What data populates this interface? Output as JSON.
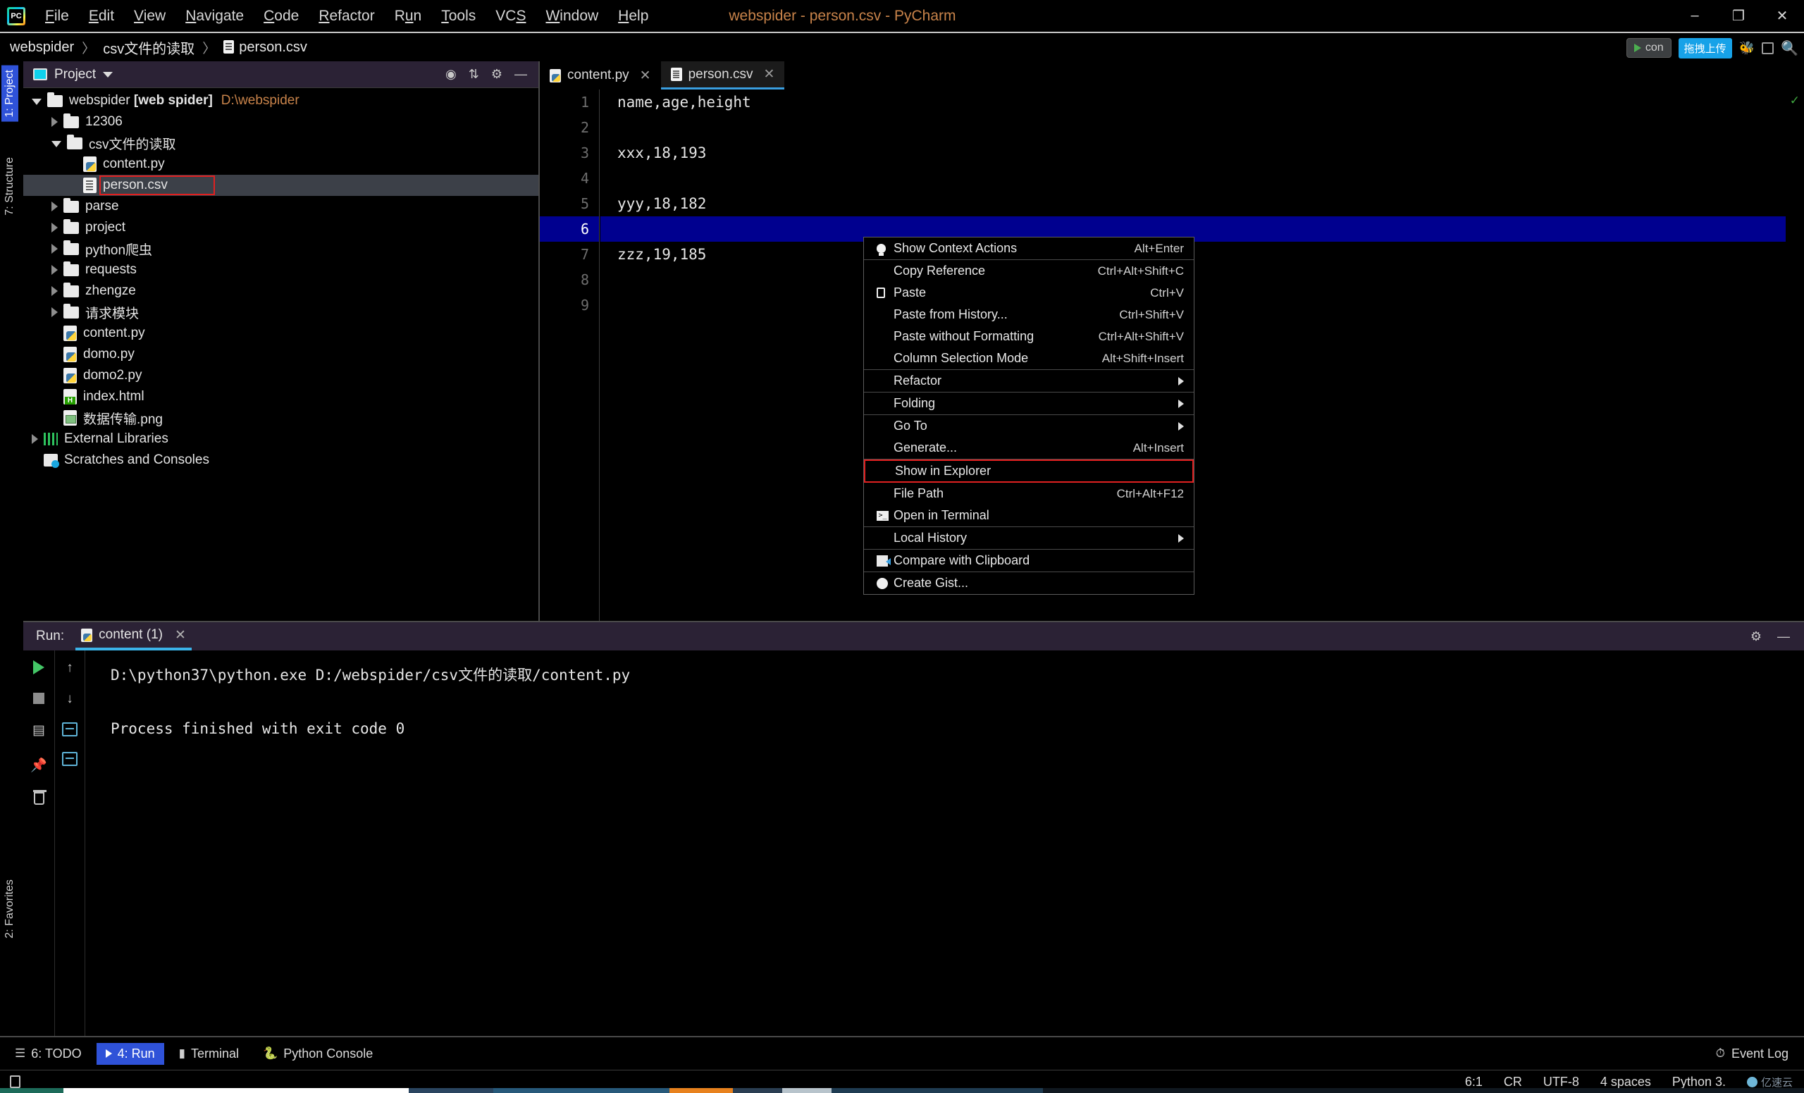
{
  "titlebar": {
    "app_icon": "pycharm-logo",
    "menus": [
      "File",
      "Edit",
      "View",
      "Navigate",
      "Code",
      "Refactor",
      "Run",
      "Tools",
      "VCS",
      "Window",
      "Help"
    ],
    "window_title": "webspider - person.csv - PyCharm",
    "title_color": "#c8834a",
    "minimize": "–",
    "maximize": "❐",
    "close": "✕"
  },
  "breadcrumb": {
    "items": [
      "webspider",
      "csv文件的读取",
      "person.csv"
    ],
    "separator": "〉",
    "run_config": "con",
    "badge_cn": "拖拽上传",
    "icons": [
      "bug-icon",
      "stop-icon",
      "search-icon"
    ]
  },
  "left_strip": {
    "tabs": [
      "1: Project",
      "7: Structure",
      "2: Favorites"
    ],
    "selected": "1: Project"
  },
  "project_panel": {
    "title": "Project",
    "header_icons": [
      "target-icon",
      "collapse-all-icon",
      "gear-icon",
      "hide-icon"
    ],
    "tree": [
      {
        "label": "webspider [web spider]",
        "path": "D:\\webspider",
        "icon": "folder",
        "depth": 0,
        "arrow": "open",
        "bold_part": "[web spider]"
      },
      {
        "label": "12306",
        "icon": "folder",
        "depth": 1,
        "arrow": "closed"
      },
      {
        "label": "csv文件的读取",
        "icon": "folder",
        "depth": 1,
        "arrow": "open"
      },
      {
        "label": "content.py",
        "icon": "python",
        "depth": 2,
        "arrow": "none"
      },
      {
        "label": "person.csv",
        "icon": "csv",
        "depth": 2,
        "arrow": "none",
        "selected": true,
        "highlighted": true
      },
      {
        "label": "parse",
        "icon": "folder",
        "depth": 1,
        "arrow": "closed"
      },
      {
        "label": "project",
        "icon": "folder",
        "depth": 1,
        "arrow": "closed"
      },
      {
        "label": "python爬虫",
        "icon": "folder",
        "depth": 1,
        "arrow": "closed"
      },
      {
        "label": "requests",
        "icon": "folder",
        "depth": 1,
        "arrow": "closed"
      },
      {
        "label": "zhengze",
        "icon": "folder",
        "depth": 1,
        "arrow": "closed"
      },
      {
        "label": "请求模块",
        "icon": "folder",
        "depth": 1,
        "arrow": "closed"
      },
      {
        "label": "content.py",
        "icon": "python",
        "depth": 1,
        "arrow": "none"
      },
      {
        "label": "domo.py",
        "icon": "python",
        "depth": 1,
        "arrow": "none"
      },
      {
        "label": "domo2.py",
        "icon": "python",
        "depth": 1,
        "arrow": "none"
      },
      {
        "label": "index.html",
        "icon": "html",
        "depth": 1,
        "arrow": "none"
      },
      {
        "label": "数据传输.png",
        "icon": "png",
        "depth": 1,
        "arrow": "none"
      },
      {
        "label": "External Libraries",
        "icon": "library",
        "depth": 0,
        "arrow": "closed"
      },
      {
        "label": "Scratches and Consoles",
        "icon": "scratch",
        "depth": 0,
        "arrow": "none"
      }
    ]
  },
  "editor": {
    "tabs": [
      {
        "label": "content.py",
        "icon": "python",
        "active": false,
        "close": "✕"
      },
      {
        "label": "person.csv",
        "icon": "csv",
        "active": true,
        "close": "✕"
      }
    ],
    "lines": [
      {
        "number": "1",
        "text": "name,age,height"
      },
      {
        "number": "2",
        "text": ""
      },
      {
        "number": "3",
        "text": "xxx,18,193"
      },
      {
        "number": "4",
        "text": ""
      },
      {
        "number": "5",
        "text": "yyy,18,182"
      },
      {
        "number": "6",
        "text": "",
        "current": true
      },
      {
        "number": "7",
        "text": "zzz,19,185"
      },
      {
        "number": "8",
        "text": ""
      },
      {
        "number": "9",
        "text": ""
      }
    ],
    "inspection_status": "✓"
  },
  "context_menu": {
    "groups": [
      [
        {
          "label": "Show Context Actions",
          "shortcut": "Alt+Enter",
          "icon": "lightbulb-icon"
        }
      ],
      [
        {
          "label": "Copy Reference",
          "shortcut": "Ctrl+Alt+Shift+C"
        },
        {
          "label": "Paste",
          "shortcut": "Ctrl+V",
          "icon": "clipboard-icon",
          "mnemonic": "P"
        },
        {
          "label": "Paste from History...",
          "shortcut": "Ctrl+Shift+V"
        },
        {
          "label": "Paste without Formatting",
          "shortcut": "Ctrl+Alt+Shift+V"
        },
        {
          "label": "Column Selection Mode",
          "shortcut": "Alt+Shift+Insert"
        }
      ],
      [
        {
          "label": "Refactor",
          "submenu": true
        }
      ],
      [
        {
          "label": "Folding",
          "submenu": true
        }
      ],
      [
        {
          "label": "Go To",
          "submenu": true
        },
        {
          "label": "Generate...",
          "shortcut": "Alt+Insert"
        }
      ],
      [
        {
          "label": "Show in Explorer",
          "marked": true
        },
        {
          "label": "File Path",
          "shortcut": "Ctrl+Alt+F12"
        },
        {
          "label": "Open in Terminal",
          "icon": "terminal-icon"
        }
      ],
      [
        {
          "label": "Local History",
          "submenu": true
        }
      ],
      [
        {
          "label": "Compare with Clipboard",
          "icon": "compare-icon"
        }
      ],
      [
        {
          "label": "Create Gist...",
          "icon": "github-icon"
        }
      ]
    ]
  },
  "run_panel": {
    "label": "Run:",
    "tab": "content (1)",
    "tab_close": "✕",
    "gutter_icons": [
      "run-icon",
      "stop-icon",
      "layout-icon",
      "pin-icon",
      "trash-icon",
      "scroll-up-icon",
      "scroll-down-icon",
      "soft-wrap-icon",
      "print-icon"
    ],
    "header_icons": [
      "gear-icon",
      "hide-icon"
    ],
    "console_lines": [
      "D:\\python37\\python.exe D:/webspider/csv文件的读取/content.py",
      "",
      "Process finished with exit code 0"
    ]
  },
  "bottom_bar": {
    "items": [
      {
        "label": "6: TODO",
        "icon": "todo-icon",
        "selected": false
      },
      {
        "label": "4: Run",
        "icon": "run-icon",
        "selected": true
      },
      {
        "label": "Terminal",
        "icon": "terminal-icon",
        "selected": false
      },
      {
        "label": "Python Console",
        "icon": "python-icon",
        "selected": false
      }
    ],
    "event_log": "Event Log",
    "event_log_icon": "bell-icon"
  },
  "status_bar": {
    "caret": "6:1",
    "line_sep": "CR",
    "encoding": "UTF-8",
    "indent": "4 spaces",
    "interpreter": "Python 3.",
    "watermark": "亿速云",
    "book_icon": "book-icon"
  }
}
